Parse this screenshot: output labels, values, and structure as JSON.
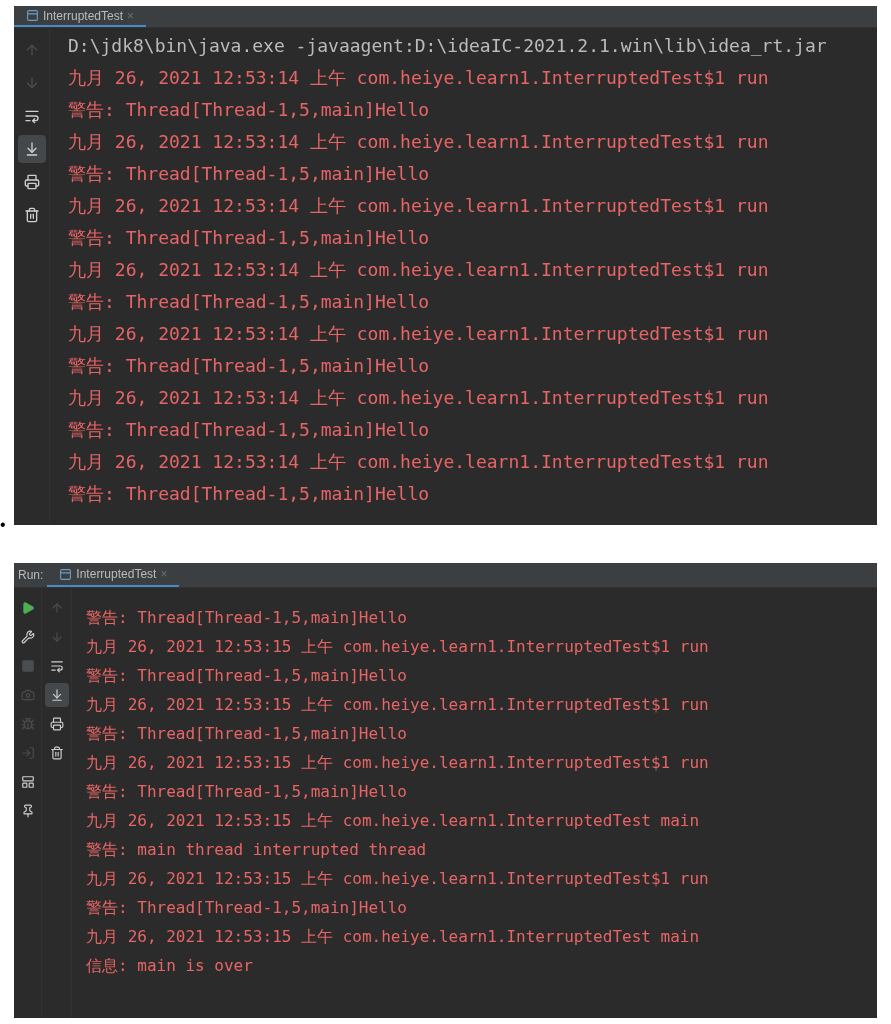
{
  "panels": [
    {
      "tab": {
        "title": "InterruptedTest",
        "close": "×",
        "selected": true
      },
      "toolbars": [
        [
          {
            "kind": "up",
            "disabled": true,
            "selected": false
          },
          {
            "kind": "down",
            "disabled": true,
            "selected": false
          },
          {
            "kind": "wrap",
            "disabled": false,
            "selected": false
          },
          {
            "kind": "scroll-end",
            "disabled": false,
            "selected": true
          },
          {
            "kind": "print",
            "disabled": false,
            "selected": false
          },
          {
            "kind": "trash",
            "disabled": false,
            "selected": false
          }
        ]
      ],
      "lines": [
        {
          "kind": "command",
          "text": "D:\\jdk8\\bin\\java.exe -javaagent:D:\\ideaIC-2021.2.1.win\\lib\\idea_rt.jar"
        },
        {
          "kind": "log",
          "text": "九月 26, 2021 12:53:14 上午 com.heiye.learn1.InterruptedTest$1 run"
        },
        {
          "kind": "log",
          "text": "警告: Thread[Thread-1,5,main]Hello"
        },
        {
          "kind": "log",
          "text": "九月 26, 2021 12:53:14 上午 com.heiye.learn1.InterruptedTest$1 run"
        },
        {
          "kind": "log",
          "text": "警告: Thread[Thread-1,5,main]Hello"
        },
        {
          "kind": "log",
          "text": "九月 26, 2021 12:53:14 上午 com.heiye.learn1.InterruptedTest$1 run"
        },
        {
          "kind": "log",
          "text": "警告: Thread[Thread-1,5,main]Hello"
        },
        {
          "kind": "log",
          "text": "九月 26, 2021 12:53:14 上午 com.heiye.learn1.InterruptedTest$1 run"
        },
        {
          "kind": "log",
          "text": "警告: Thread[Thread-1,5,main]Hello"
        },
        {
          "kind": "log",
          "text": "九月 26, 2021 12:53:14 上午 com.heiye.learn1.InterruptedTest$1 run"
        },
        {
          "kind": "log",
          "text": "警告: Thread[Thread-1,5,main]Hello"
        },
        {
          "kind": "log",
          "text": "九月 26, 2021 12:53:14 上午 com.heiye.learn1.InterruptedTest$1 run"
        },
        {
          "kind": "log",
          "text": "警告: Thread[Thread-1,5,main]Hello"
        },
        {
          "kind": "log",
          "text": "九月 26, 2021 12:53:14 上午 com.heiye.learn1.InterruptedTest$1 run"
        },
        {
          "kind": "log",
          "text": "警告: Thread[Thread-1,5,main]Hello"
        }
      ]
    },
    {
      "run_label": "Run:",
      "tab": {
        "title": "InterruptedTest",
        "close": "×",
        "selected": true
      },
      "toolbars": [
        [
          {
            "kind": "play",
            "disabled": false,
            "selected": false
          },
          {
            "kind": "wrench",
            "disabled": false,
            "selected": false
          },
          {
            "kind": "stop",
            "disabled": true,
            "selected": false
          },
          {
            "kind": "camera",
            "disabled": true,
            "selected": false
          },
          {
            "kind": "bug",
            "disabled": true,
            "selected": false
          },
          {
            "kind": "login",
            "disabled": true,
            "selected": false
          },
          {
            "kind": "layout",
            "disabled": false,
            "selected": false
          },
          {
            "kind": "pin",
            "disabled": false,
            "selected": false
          }
        ],
        [
          {
            "kind": "up",
            "disabled": true,
            "selected": false
          },
          {
            "kind": "down",
            "disabled": true,
            "selected": false
          },
          {
            "kind": "wrap",
            "disabled": false,
            "selected": false
          },
          {
            "kind": "scroll-end",
            "disabled": false,
            "selected": true
          },
          {
            "kind": "print",
            "disabled": false,
            "selected": false
          },
          {
            "kind": "trash",
            "disabled": false,
            "selected": false
          }
        ]
      ],
      "lines": [
        {
          "kind": "log",
          "text": "警告: Thread[Thread-1,5,main]Hello"
        },
        {
          "kind": "log",
          "text": "九月 26, 2021 12:53:15 上午 com.heiye.learn1.InterruptedTest$1 run"
        },
        {
          "kind": "log",
          "text": "警告: Thread[Thread-1,5,main]Hello"
        },
        {
          "kind": "log",
          "text": "九月 26, 2021 12:53:15 上午 com.heiye.learn1.InterruptedTest$1 run"
        },
        {
          "kind": "log",
          "text": "警告: Thread[Thread-1,5,main]Hello"
        },
        {
          "kind": "log",
          "text": "九月 26, 2021 12:53:15 上午 com.heiye.learn1.InterruptedTest$1 run"
        },
        {
          "kind": "log",
          "text": "警告: Thread[Thread-1,5,main]Hello"
        },
        {
          "kind": "log",
          "text": "九月 26, 2021 12:53:15 上午 com.heiye.learn1.InterruptedTest main"
        },
        {
          "kind": "log",
          "text": "警告: main thread interrupted thread"
        },
        {
          "kind": "log",
          "text": "九月 26, 2021 12:53:15 上午 com.heiye.learn1.InterruptedTest$1 run"
        },
        {
          "kind": "log",
          "text": "警告: Thread[Thread-1,5,main]Hello"
        },
        {
          "kind": "log",
          "text": "九月 26, 2021 12:53:15 上午 com.heiye.learn1.InterruptedTest main"
        },
        {
          "kind": "log",
          "text": "信息: main is over"
        }
      ]
    }
  ],
  "bullet": "•"
}
